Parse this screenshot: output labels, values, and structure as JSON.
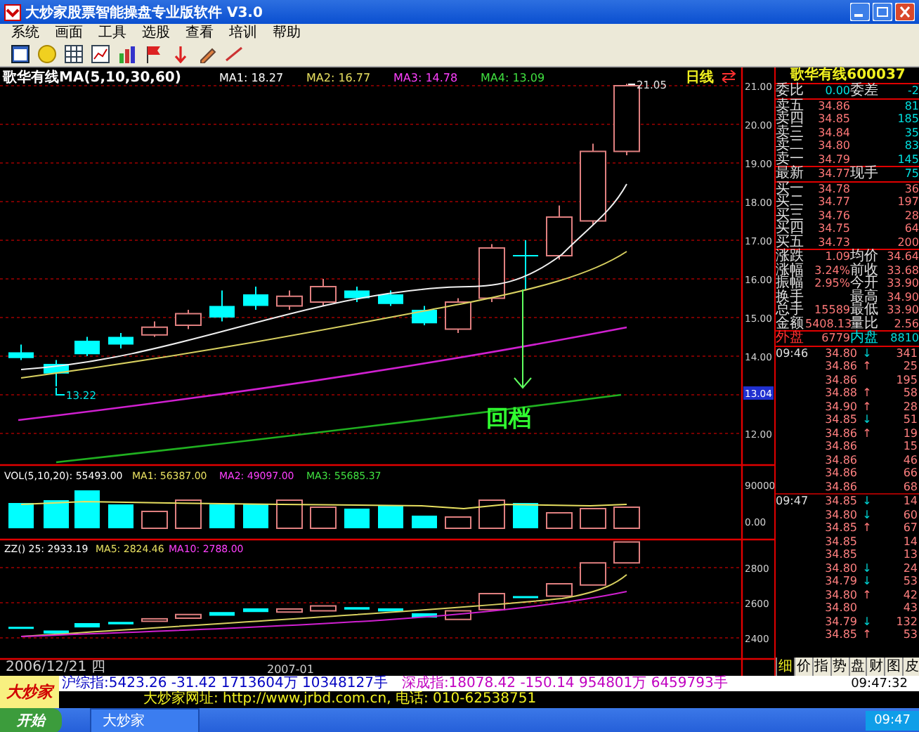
{
  "window": {
    "title": "大炒家股票智能操盘专业版软件 V3.0"
  },
  "menu": [
    "系统",
    "画面",
    "工具",
    "选股",
    "查看",
    "培训",
    "帮助"
  ],
  "chart": {
    "header": [
      {
        "text": "歌华有线MA(5,10,30,60)",
        "color": "#ffffff"
      },
      {
        "text": "MA1: 18.27",
        "color": "#ffffff"
      },
      {
        "text": "MA2: 16.77",
        "color": "#e8e060"
      },
      {
        "text": "MA3: 14.78",
        "color": "#ff40ff"
      },
      {
        "text": "MA4: 13.09",
        "color": "#40e040"
      }
    ],
    "period": "日线",
    "price_labels": [
      "21.00",
      "20.00",
      "19.00",
      "18.00",
      "17.00",
      "16.00",
      "15.00",
      "14.00",
      "12.00"
    ],
    "current_price": "13.04",
    "high_label": "21.05",
    "low_label": "13.22",
    "annotation": "回档",
    "volume": {
      "header": [
        {
          "text": "VOL(5,10,20): 55493.00",
          "color": "#ffffff"
        },
        {
          "text": "MA1: 56387.00",
          "color": "#e8e060"
        },
        {
          "text": "MA2: 49097.00",
          "color": "#ff40ff"
        },
        {
          "text": "MA3: 55685.37",
          "color": "#40e040"
        }
      ],
      "axis": [
        "90000",
        "0.00"
      ]
    },
    "indicator": {
      "header": [
        {
          "text": "ZZ() 25: 2933.19",
          "color": "#ffffff"
        },
        {
          "text": "MA5: 2824.46",
          "color": "#e8e060"
        },
        {
          "text": "MA10: 2788.00",
          "color": "#ff40ff"
        }
      ],
      "axis": [
        "2800",
        "2600",
        "2400"
      ]
    },
    "dates": [
      "2006/12/21 四",
      "2007-01"
    ]
  },
  "quote": {
    "title": "歌华有线600037",
    "rows": [
      {
        "kind": "ratio",
        "label": "委比",
        "value": "0.00",
        "label2": "委差",
        "value2": "-2"
      },
      {
        "kind": "sell",
        "label": "卖五",
        "value": "34.86",
        "value2": "81"
      },
      {
        "kind": "sell",
        "label": "卖四",
        "value": "34.85",
        "value2": "185"
      },
      {
        "kind": "sell",
        "label": "卖三",
        "value": "34.84",
        "value2": "35"
      },
      {
        "kind": "sell",
        "label": "卖二",
        "value": "34.80",
        "value2": "83"
      },
      {
        "kind": "sell",
        "label": "卖一",
        "value": "34.79",
        "value2": "145"
      },
      {
        "kind": "last",
        "label": "最新",
        "value": "34.77",
        "label2": "现手",
        "value2": "75"
      },
      {
        "kind": "buy",
        "label": "买一",
        "value": "34.78",
        "value2": "36"
      },
      {
        "kind": "buy",
        "label": "买二",
        "value": "34.77",
        "value2": "197"
      },
      {
        "kind": "buy",
        "label": "买三",
        "value": "34.76",
        "value2": "28"
      },
      {
        "kind": "buy",
        "label": "买四",
        "value": "34.75",
        "value2": "64"
      },
      {
        "kind": "buy",
        "label": "买五",
        "value": "34.73",
        "value2": "200"
      },
      {
        "kind": "stat",
        "label": "涨跌",
        "value": "1.09",
        "label2": "均价",
        "value2": "34.64"
      },
      {
        "kind": "stat",
        "label": "涨幅",
        "value": "3.24%",
        "label2": "前收",
        "value2": "33.68"
      },
      {
        "kind": "stat",
        "label": "振幅",
        "value": "2.95%",
        "label2": "今开",
        "value2": "33.90"
      },
      {
        "kind": "stat",
        "label": "换手",
        "label2": "最高",
        "value2": "34.90"
      },
      {
        "kind": "stat",
        "label": "总手",
        "value": "15589",
        "label2": "最低",
        "value2": "33.90"
      },
      {
        "kind": "stat",
        "label": "金额",
        "value": "5408.13",
        "label2": "量比",
        "value2": "2.56"
      },
      {
        "kind": "outer",
        "label": "外盘",
        "value": "6779",
        "label2": "内盘",
        "value2": "8810"
      }
    ]
  },
  "ticks": [
    {
      "time": "09:46",
      "price": "34.80",
      "arrow": "↓",
      "color": "#00d0d0",
      "volume": "341"
    },
    {
      "price": "34.86",
      "arrow": "↑",
      "color": "#ff7878",
      "volume": "25"
    },
    {
      "price": "34.86",
      "volume": "195"
    },
    {
      "price": "34.88",
      "arrow": "↑",
      "color": "#ff7878",
      "volume": "58"
    },
    {
      "price": "34.90",
      "arrow": "↑",
      "color": "#ff7878",
      "volume": "28"
    },
    {
      "price": "34.85",
      "arrow": "↓",
      "color": "#00d0d0",
      "volume": "51"
    },
    {
      "price": "34.86",
      "arrow": "↑",
      "color": "#ff7878",
      "volume": "19"
    },
    {
      "price": "34.86",
      "volume": "15"
    },
    {
      "price": "34.86",
      "volume": "46"
    },
    {
      "price": "34.86",
      "volume": "66"
    },
    {
      "price": "34.86",
      "volume": "68"
    },
    {
      "time": "09:47",
      "price": "34.85",
      "arrow": "↓",
      "color": "#00d0d0",
      "volume": "14"
    },
    {
      "price": "34.80",
      "arrow": "↓",
      "color": "#00d0d0",
      "volume": "60"
    },
    {
      "price": "34.85",
      "arrow": "↑",
      "color": "#ff7878",
      "volume": "67"
    },
    {
      "price": "34.85",
      "volume": "14"
    },
    {
      "price": "34.85",
      "volume": "13"
    },
    {
      "price": "34.80",
      "arrow": "↓",
      "color": "#00d0d0",
      "volume": "24"
    },
    {
      "price": "34.79",
      "arrow": "↓",
      "color": "#00d0d0",
      "volume": "53"
    },
    {
      "price": "34.80",
      "arrow": "↑",
      "color": "#ff7878",
      "volume": "42"
    },
    {
      "price": "34.80",
      "volume": "43"
    },
    {
      "price": "34.79",
      "arrow": "↓",
      "color": "#00d0d0",
      "volume": "132"
    },
    {
      "price": "34.85",
      "arrow": "↑",
      "color": "#ff7878",
      "volume": "53"
    }
  ],
  "tabs": [
    {
      "label": "细",
      "selected": true
    },
    {
      "label": "价",
      "selected": false
    },
    {
      "label": "指",
      "selected": false
    },
    {
      "label": "势",
      "selected": false
    },
    {
      "label": "盘",
      "selected": false
    },
    {
      "label": "财",
      "selected": false
    },
    {
      "label": "图",
      "selected": false
    },
    {
      "label": "皮",
      "selected": false
    }
  ],
  "index_bar": {
    "items": [
      "沪综指:5423.26 -31.42 1713604万 10348127手",
      "深成指:18078.42 -150.14 954801万 6459793手"
    ],
    "time": "09:47:32"
  },
  "logo": "大炒家",
  "website": "大炒家网址: http://www.jrbd.com.cn, 电话: 010-62538751",
  "taskbar": {
    "start": "开始",
    "task": "大炒家",
    "clock": "09:47"
  }
}
